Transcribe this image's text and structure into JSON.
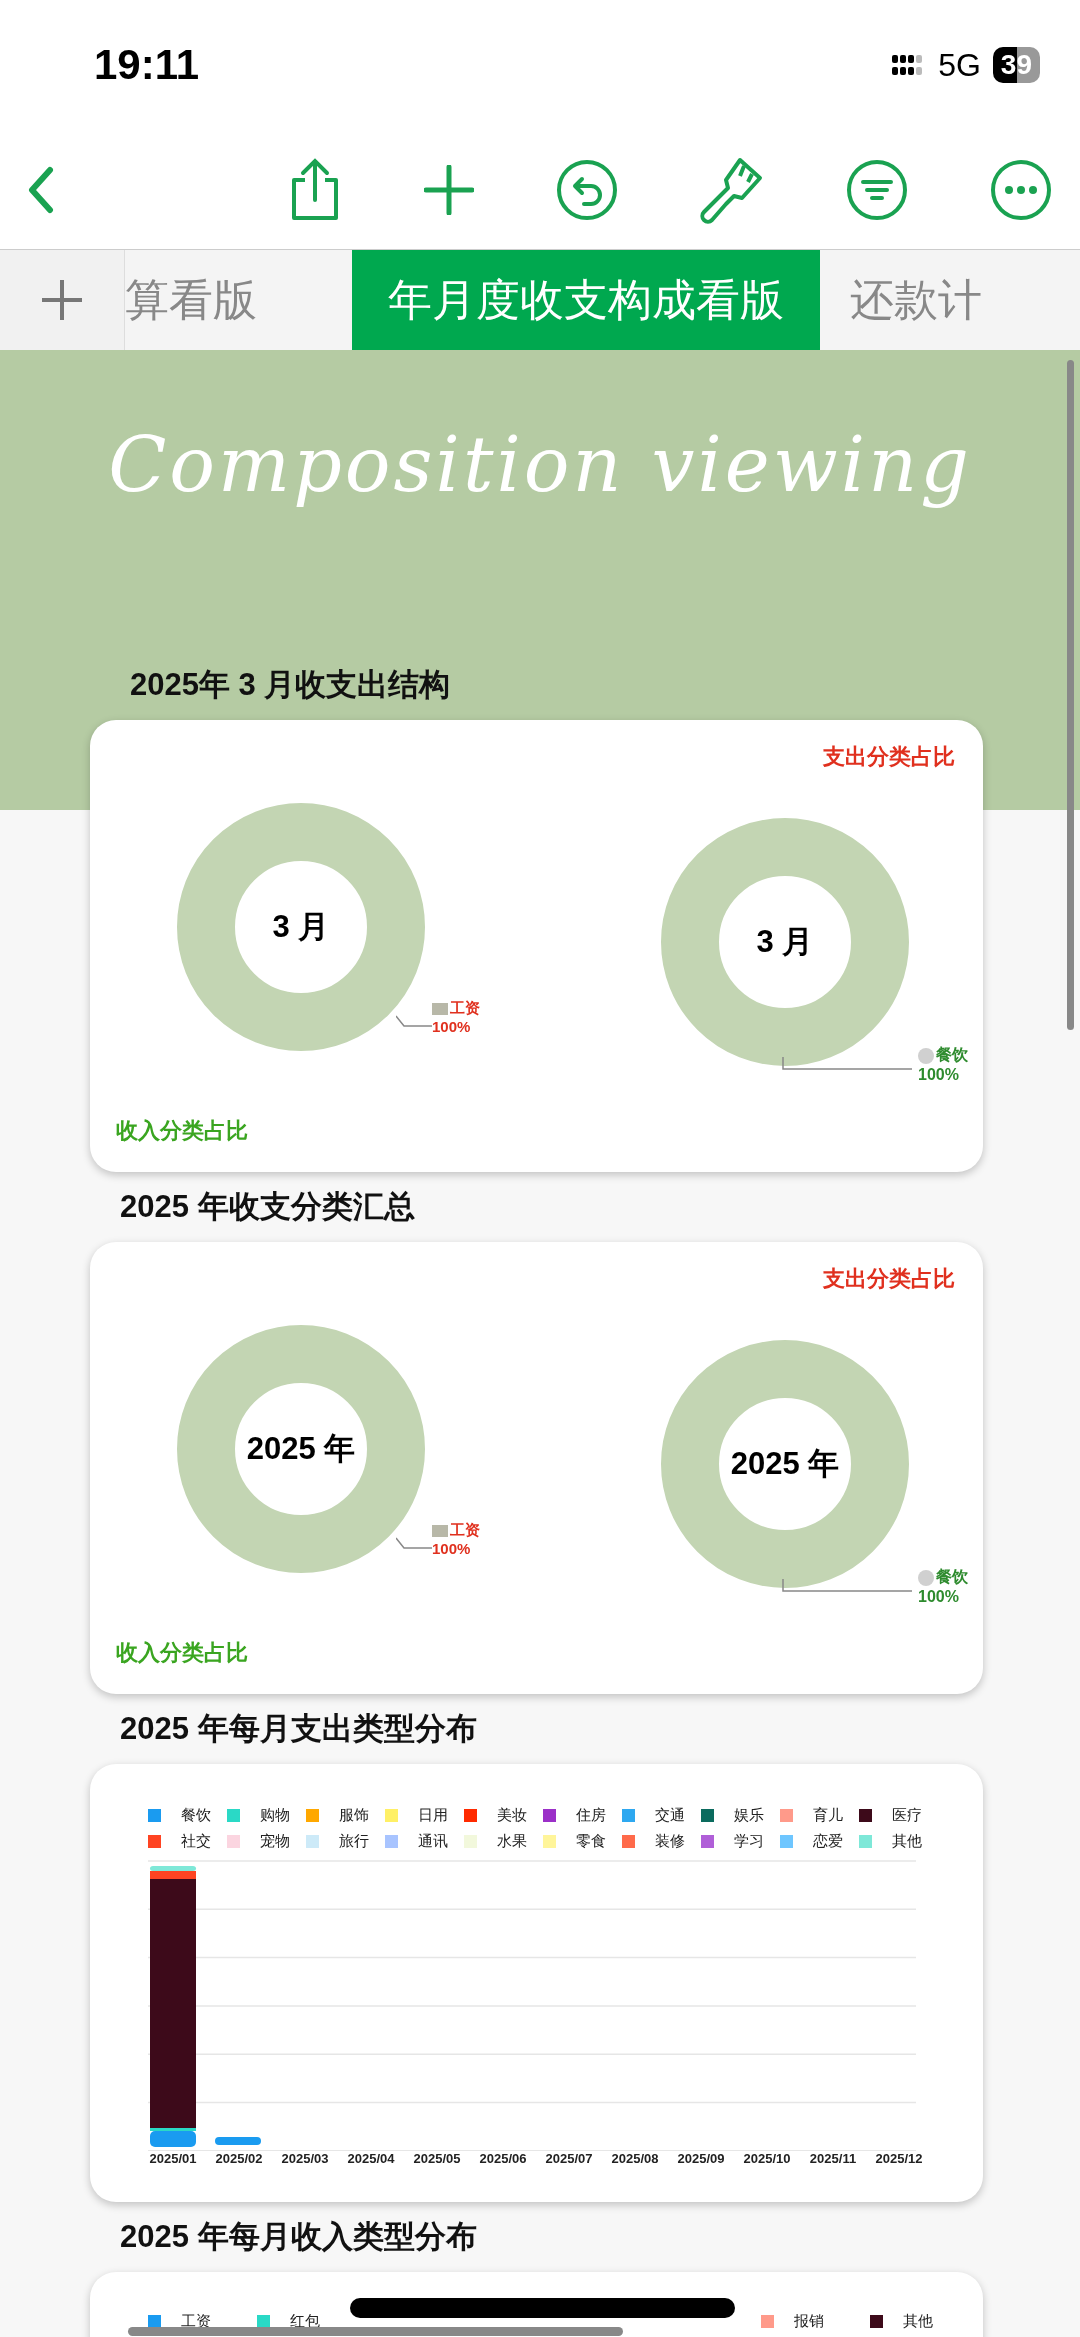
{
  "status_bar": {
    "time": "19:11",
    "network": "5G",
    "battery": "39"
  },
  "tabs": [
    {
      "label": "算看版",
      "selected": false
    },
    {
      "label": "年月度收支构成看版",
      "selected": true
    },
    {
      "label": "还款计",
      "selected": false
    }
  ],
  "banner": {
    "title": "Composition viewing"
  },
  "sections": [
    {
      "kind": "donuts",
      "title": "2025年 3 月收支出结构",
      "expense_title": "支出分类占比",
      "income_title": "收入分类占比",
      "donuts": [
        {
          "center": "3 月",
          "label": "工资",
          "percent": "100%",
          "color": "#e0301e"
        },
        {
          "center": "3 月",
          "label": "餐饮",
          "percent": "100%",
          "color": "#2e8b2e"
        }
      ]
    },
    {
      "kind": "donuts",
      "title": "2025 年收支分类汇总",
      "expense_title": "支出分类占比",
      "income_title": "收入分类占比",
      "donuts": [
        {
          "center": "2025 年",
          "label": "工资",
          "percent": "100%",
          "color": "#e0301e"
        },
        {
          "center": "2025 年",
          "label": "餐饮",
          "percent": "100%",
          "color": "#2e8b2e"
        }
      ]
    },
    {
      "kind": "bars",
      "title": "2025 年每月支出类型分布",
      "legend": [
        {
          "label": "餐饮",
          "color": "#1a9bf0"
        },
        {
          "label": "购物",
          "color": "#2ad9c6"
        },
        {
          "label": "服饰",
          "color": "#ffa800"
        },
        {
          "label": "日用",
          "color": "#fff066"
        },
        {
          "label": "美妆",
          "color": "#ff2a00"
        },
        {
          "label": "住房",
          "color": "#9b30c8"
        },
        {
          "label": "交通",
          "color": "#2ea8f0"
        },
        {
          "label": "娱乐",
          "color": "#0b6b5e"
        },
        {
          "label": "育儿",
          "color": "#ff9a8a"
        },
        {
          "label": "医疗",
          "color": "#3d0a1a"
        },
        {
          "label": "社交",
          "color": "#ff4422"
        },
        {
          "label": "宠物",
          "color": "#fbd5e0"
        },
        {
          "label": "旅行",
          "color": "#cdeaf8"
        },
        {
          "label": "通讯",
          "color": "#a8c4ff"
        },
        {
          "label": "水果",
          "color": "#f2f8dc"
        },
        {
          "label": "零食",
          "color": "#fff59a"
        },
        {
          "label": "装修",
          "color": "#ff6a4a"
        },
        {
          "label": "学习",
          "color": "#b05fd8"
        },
        {
          "label": "恋爱",
          "color": "#6ec6ff"
        },
        {
          "label": "其他",
          "color": "#7ee8d8"
        }
      ],
      "x_labels": [
        "2025/01",
        "2025/02",
        "2025/03",
        "2025/04",
        "2025/05",
        "2025/06",
        "2025/07",
        "2025/08",
        "2025/09",
        "2025/10",
        "2025/11",
        "2025/12"
      ]
    },
    {
      "kind": "legend",
      "title": "2025 年每月收入类型分布",
      "legend": [
        {
          "label": "工资",
          "color": "#1a9bf0"
        },
        {
          "label": "红包",
          "color": "#2ad9c6"
        },
        {
          "label": "报销",
          "color": "#ff9a8a"
        },
        {
          "label": "其他",
          "color": "#3d0a1a"
        }
      ]
    }
  ]
}
